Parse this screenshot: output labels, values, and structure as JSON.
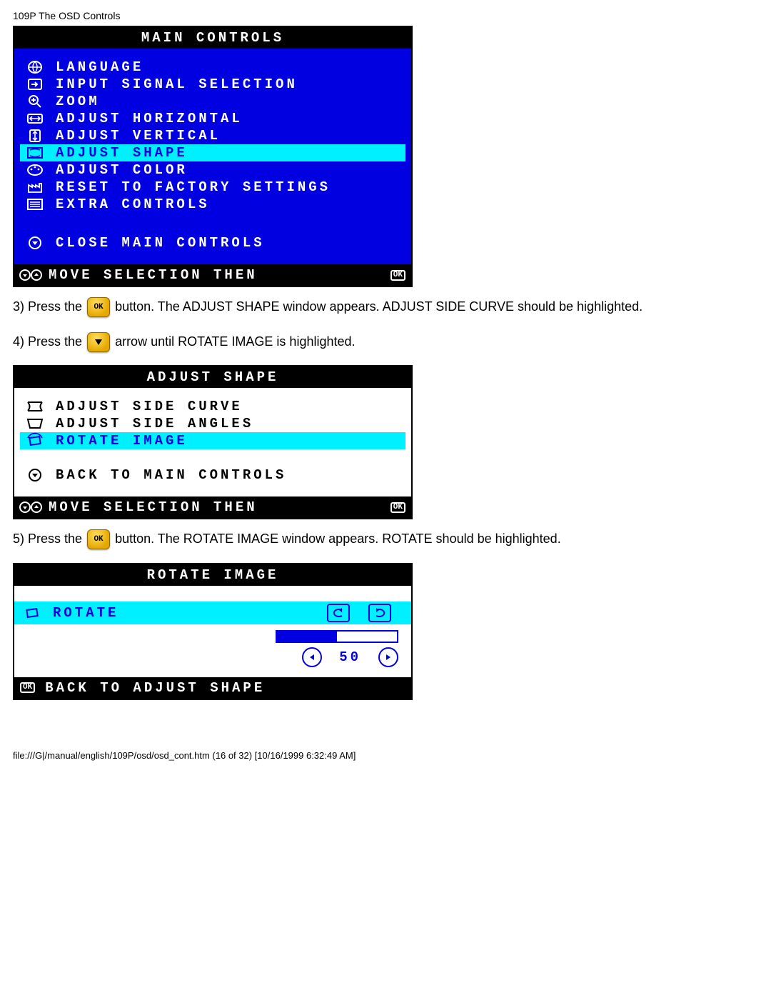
{
  "header": "109P The OSD Controls",
  "main_controls": {
    "title": "MAIN CONTROLS",
    "items": [
      "LANGUAGE",
      "INPUT SIGNAL SELECTION",
      "ZOOM",
      "ADJUST HORIZONTAL",
      "ADJUST VERTICAL",
      "ADJUST SHAPE",
      "ADJUST COLOR",
      "RESET TO FACTORY SETTINGS",
      "EXTRA CONTROLS"
    ],
    "close": "CLOSE MAIN CONTROLS",
    "footer": "MOVE SELECTION THEN"
  },
  "instruction3a": "3) Press the ",
  "instruction3b": " button. The ADJUST SHAPE window appears. ADJUST SIDE CURVE should be highlighted.",
  "instruction4a": "4) Press the ",
  "instruction4b": " arrow until ROTATE IMAGE is highlighted.",
  "adjust_shape": {
    "title": "ADJUST SHAPE",
    "items": [
      "ADJUST SIDE CURVE",
      "ADJUST SIDE ANGLES",
      "ROTATE IMAGE"
    ],
    "back": "BACK TO MAIN CONTROLS",
    "footer": "MOVE SELECTION THEN"
  },
  "instruction5a": "5) Press the ",
  "instruction5b": " button. The ROTATE IMAGE window appears. ROTATE should be highlighted.",
  "rotate_image": {
    "title": "ROTATE IMAGE",
    "item": "ROTATE",
    "value": "50",
    "back": "BACK TO ADJUST SHAPE"
  },
  "footer": "file:///G|/manual/english/109P/osd/osd_cont.htm (16 of 32) [10/16/1999 6:32:49 AM]"
}
